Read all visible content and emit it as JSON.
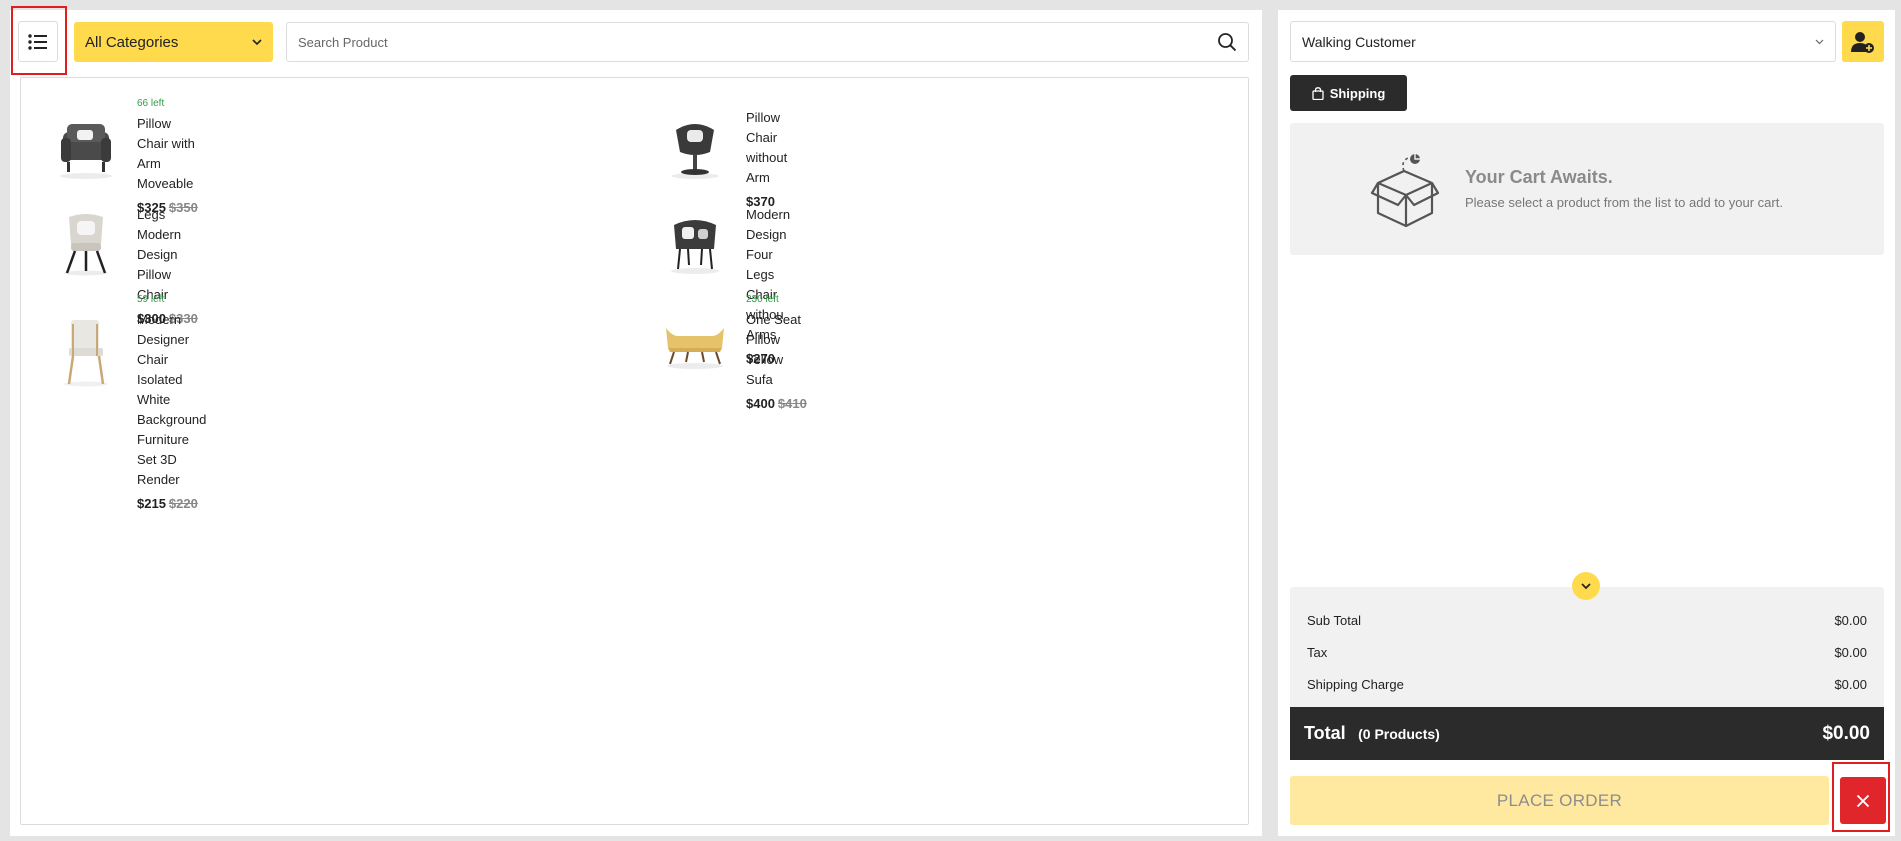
{
  "toolbar": {
    "category_label": "All Categories",
    "search_placeholder": "Search Product"
  },
  "products": [
    {
      "name": "Pillow Chair with Arm Moveable",
      "stock": "66 left",
      "price": "$325",
      "old_price": "$350"
    },
    {
      "name": "Pillow Chair without Arm",
      "stock": "",
      "price": "$370",
      "old_price": ""
    },
    {
      "name": "Legs Modern Design Pillow Chair",
      "stock": "",
      "price": "$300",
      "old_price": "$330"
    },
    {
      "name": "Modern Design Four Legs Chair withou Arms",
      "stock": "",
      "price": "$270",
      "old_price": ""
    },
    {
      "name": "Modern Designer Chair Isolated White Background Furniture Set 3D Render",
      "stock": "59 left",
      "price": "$215",
      "old_price": "$220"
    },
    {
      "name": "One Seat Pillow Yellow Sufa",
      "stock": "230 left",
      "price": "$400",
      "old_price": "$410"
    }
  ],
  "cart": {
    "customer": "Walking Customer",
    "shipping_label": "Shipping",
    "empty_title": "Your Cart Awaits.",
    "empty_sub": "Please select a product from the list to add to your cart.",
    "summary": {
      "subtotal_label": "Sub Total",
      "subtotal_value": "$0.00",
      "tax_label": "Tax",
      "tax_value": "$0.00",
      "shipping_label": "Shipping Charge",
      "shipping_value": "$0.00"
    },
    "total_label": "Total",
    "total_count": "(0 Products)",
    "total_value": "$0.00",
    "place_order_label": "PLACE ORDER"
  },
  "colors": {
    "accent": "#ffda4d",
    "dark": "#2b2b2b",
    "danger": "#e0262b",
    "stock": "#2f9e44",
    "highlight": "#e01e1e"
  }
}
